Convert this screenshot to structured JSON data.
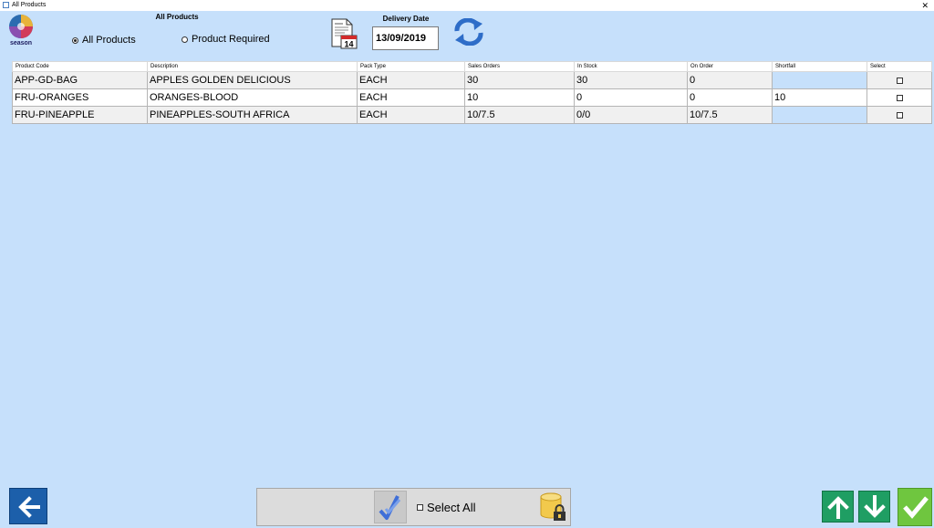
{
  "window": {
    "title": "All Products",
    "close_glyph": "✕"
  },
  "logo": {
    "text": "season"
  },
  "filter": {
    "title": "All Products",
    "options": [
      {
        "label": "All Products",
        "selected": true
      },
      {
        "label": "Product Required",
        "selected": false
      }
    ]
  },
  "calendar_icon": {
    "day": "14"
  },
  "delivery": {
    "label": "Delivery Date",
    "value": "13/09/2019"
  },
  "table": {
    "columns": [
      "Product Code",
      "Description",
      "Pack Type",
      "Sales Orders",
      "In Stock",
      "On Order",
      "Shortfall",
      "Select"
    ],
    "rows": [
      {
        "code": "APP-GD-BAG",
        "description": "APPLES GOLDEN DELICIOUS",
        "pack": "EACH",
        "sales": "30",
        "stock": "30",
        "order": "0",
        "shortfall": "",
        "selected": false
      },
      {
        "code": "FRU-ORANGES",
        "description": "ORANGES-BLOOD",
        "pack": "EACH",
        "sales": "10",
        "stock": "0",
        "order": "0",
        "shortfall": "10",
        "selected": false
      },
      {
        "code": "FRU-PINEAPPLE",
        "description": "PINEAPPLES-SOUTH AFRICA",
        "pack": "EACH",
        "sales": "10/7.5",
        "stock": "0/0",
        "order": "10/7.5",
        "shortfall": "",
        "selected": false
      }
    ]
  },
  "bottom": {
    "select_all_label": "Select All"
  },
  "icons": {
    "back": "arrow-left-icon",
    "up": "arrow-up-icon",
    "down": "arrow-down-icon",
    "ok": "checkmark-icon",
    "refresh": "refresh-icon",
    "calendar": "calendar-document-icon",
    "database": "database-lock-icon",
    "tick": "double-check-icon"
  },
  "colors": {
    "background": "#c6e0fb",
    "back_button": "#1c5faa",
    "nav_buttons": "#1f9e63",
    "ok_button": "#6fc63f"
  }
}
